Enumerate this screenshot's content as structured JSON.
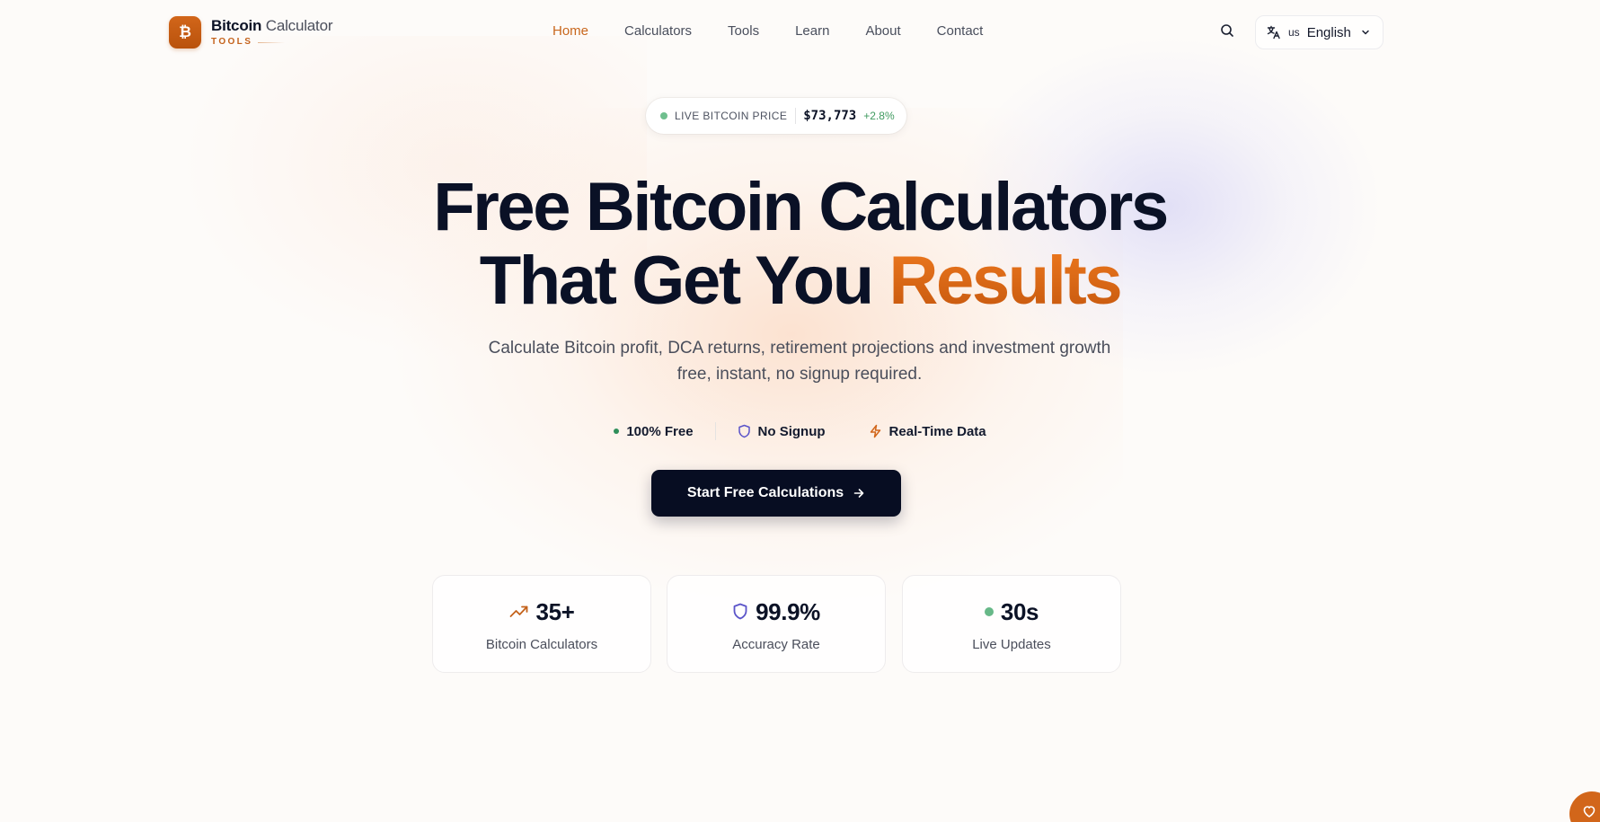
{
  "header": {
    "logo": {
      "title_bold": "Bitcoin",
      "title_light": "Calculator",
      "subtitle": "TOOLS",
      "mark": "₿"
    },
    "nav": [
      {
        "label": "Home",
        "active": true
      },
      {
        "label": "Calculators",
        "active": false
      },
      {
        "label": "Tools",
        "active": false
      },
      {
        "label": "Learn",
        "active": false
      },
      {
        "label": "About",
        "active": false
      },
      {
        "label": "Contact",
        "active": false
      }
    ],
    "language": {
      "code": "us",
      "name": "English"
    }
  },
  "live_price": {
    "label": "LIVE BITCOIN PRICE",
    "value": "$73,773",
    "change": "+2.8%"
  },
  "hero": {
    "title_line1": "Free Bitcoin Calculators",
    "title_line2_prefix": "That Get You ",
    "title_line2_accent": "Results",
    "subtitle": "Calculate Bitcoin profit, DCA returns, retirement projections and investment growth free, instant, no signup required."
  },
  "features": [
    {
      "label": "100% Free",
      "icon": "dot-icon"
    },
    {
      "label": "No Signup",
      "icon": "shield-icon"
    },
    {
      "label": "Real-Time Data",
      "icon": "bolt-icon"
    }
  ],
  "cta": {
    "label": "Start Free Calculations",
    "icon": "arrow-right-icon"
  },
  "stats": [
    {
      "value": "35+",
      "label": "Bitcoin Calculators",
      "icon": "trending-up-icon"
    },
    {
      "value": "99.9%",
      "label": "Accuracy Rate",
      "icon": "shield-icon"
    },
    {
      "value": "30s",
      "label": "Live Updates",
      "icon": "status-dot-icon"
    }
  ],
  "colors": {
    "brand": "#d2661a",
    "accent_text": "#e06a15",
    "dark": "#070d22",
    "live_green": "#6fbf8e",
    "shield_purple": "#5b54c9"
  }
}
